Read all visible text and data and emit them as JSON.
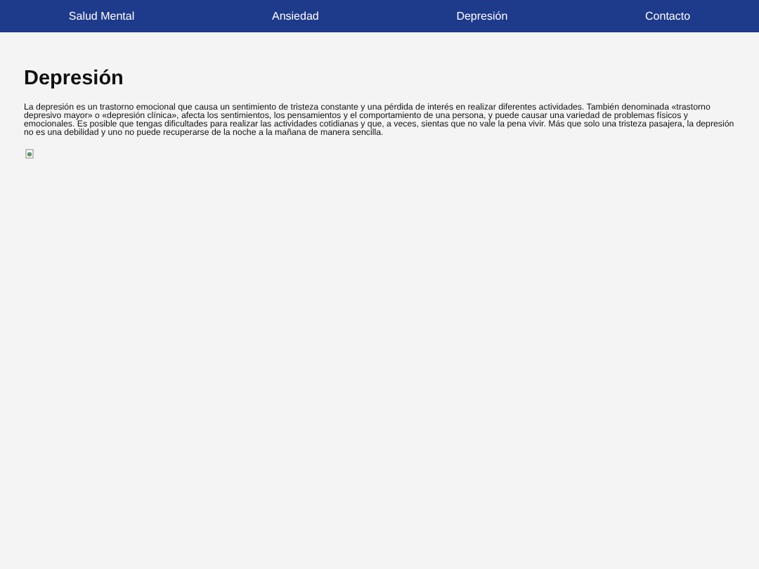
{
  "nav": [
    {
      "label": "Salud Mental"
    },
    {
      "label": "Ansiedad"
    },
    {
      "label": "Depresión"
    },
    {
      "label": "Contacto"
    }
  ],
  "title": "Depresión",
  "paragraph": "La depresión es un trastorno emocional que causa un sentimiento de tristeza constante y una pérdida de interés en realizar diferentes actividades. También denominada «trastorno depresivo mayor» o «depresión clínica», afecta los sentimientos, los pensamientos y el comportamiento de una persona, y puede causar una variedad de problemas físicos y emocionales. Es posible que tengas dificultades para realizar las actividades cotidianas y que, a veces, sientas que no vale la pena vivir. Más que solo una tristeza pasajera, la depresión no es una debilidad y uno no puede recuperarse de la noche a la mañana de manera sencilla."
}
